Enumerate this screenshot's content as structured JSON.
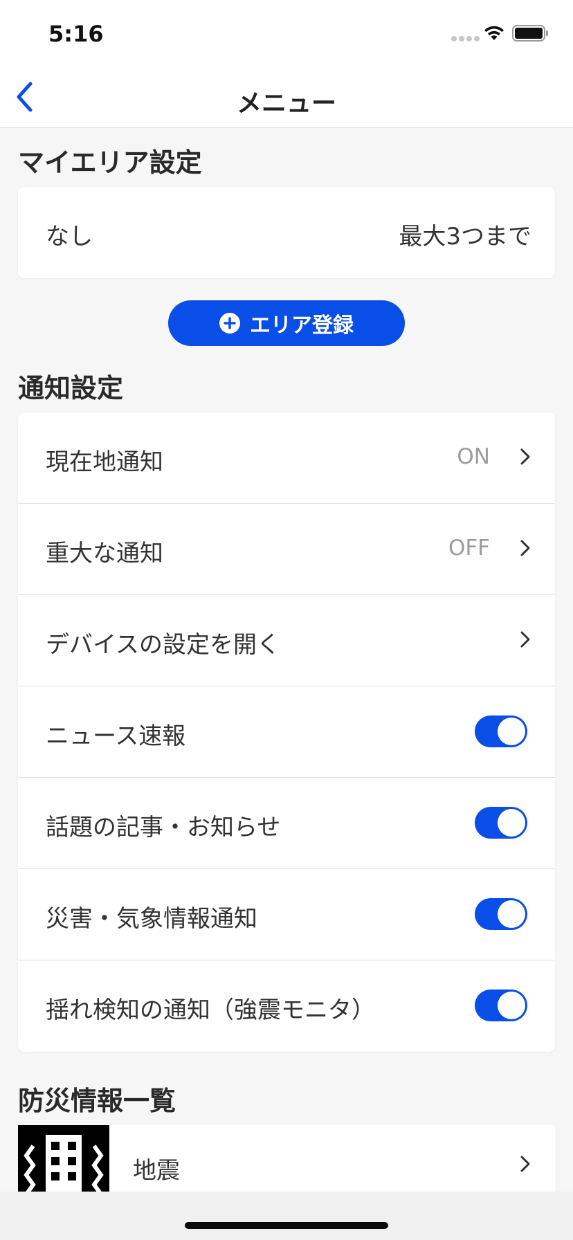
{
  "status_bar": {
    "time": "5:16"
  },
  "nav": {
    "title": "メニュー"
  },
  "my_area": {
    "section_title": "マイエリア設定",
    "current": "なし",
    "limit": "最大3つまで",
    "add_button_label": "エリア登録"
  },
  "notification": {
    "section_title": "通知設定",
    "rows": [
      {
        "label": "現在地通知",
        "value": "ON"
      },
      {
        "label": "重大な通知",
        "value": "OFF"
      },
      {
        "label": "デバイスの設定を開く"
      },
      {
        "label": "ニュース速報",
        "toggle": true
      },
      {
        "label": "話題の記事・お知らせ",
        "toggle": true
      },
      {
        "label": "災害・気象情報通知",
        "toggle": true
      },
      {
        "label": "揺れ検知の通知（強震モニタ）",
        "toggle": true
      }
    ]
  },
  "disaster_info": {
    "section_title": "防災情報一覧",
    "items": [
      {
        "label": "地震",
        "icon": "earthquake-building-icon"
      }
    ]
  },
  "colors": {
    "accent": "#0a4ee8",
    "secondary_text": "#9b9b9b",
    "background": "#f6f6f6"
  }
}
